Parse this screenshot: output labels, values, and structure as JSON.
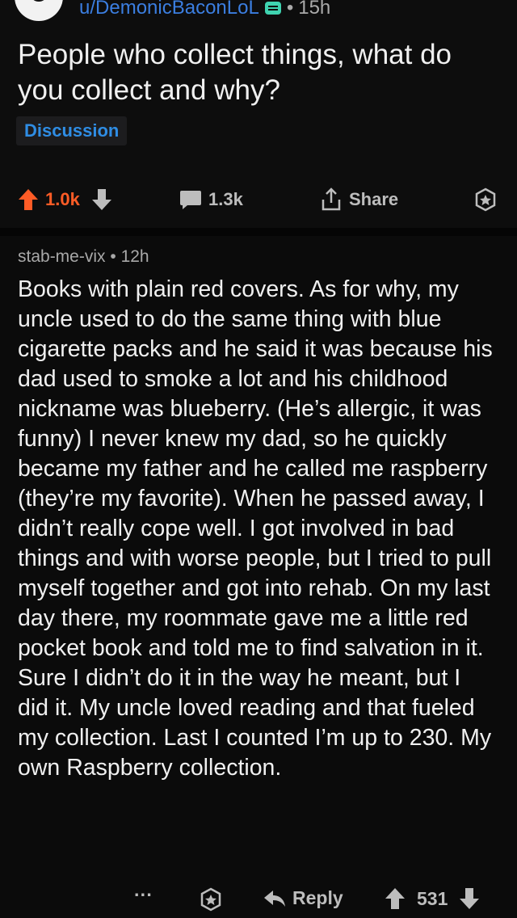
{
  "post": {
    "author": "u/DemonicBaconLoL",
    "separator": "•",
    "time": "15h",
    "title": "People who collect things, what do you collect and why?",
    "flair": "Discussion",
    "upvotes": "1.0k",
    "comments": "1.3k",
    "share_label": "Share"
  },
  "comment": {
    "author": "stab-me-vix",
    "separator": "•",
    "time": "12h",
    "body": "Books with plain red covers. As for why, my uncle used to do the same thing with blue cigarette packs and he said it was because his dad used to smoke a lot and his childhood nickname was blueberry. (He’s allergic, it was funny) I never knew my dad, so he quickly became my father and he called me raspberry (they’re my favorite). When he passed away, I didn’t really cope well. I got involved in bad things and with worse people, but I tried to pull myself together and got into rehab. On my last day there, my roommate gave me a little red pocket book and told me to find salvation in it. Sure I didn’t do it in the way he meant, but I did it. My uncle loved reading and that fueled my collection. Last I counted I’m up to 230. My own Raspberry collection.",
    "more_label": "···",
    "reply_label": "Reply",
    "score": "531"
  },
  "colors": {
    "upvote": "#ff5c26",
    "link_blue": "#3b7ee0",
    "flair_blue": "#2f8de4",
    "mod_badge": "#3fd3b0"
  },
  "icons": [
    "avatar",
    "mod-badge-icon",
    "upvote-icon",
    "downvote-icon",
    "comment-icon",
    "share-icon",
    "award-icon",
    "reply-icon"
  ]
}
